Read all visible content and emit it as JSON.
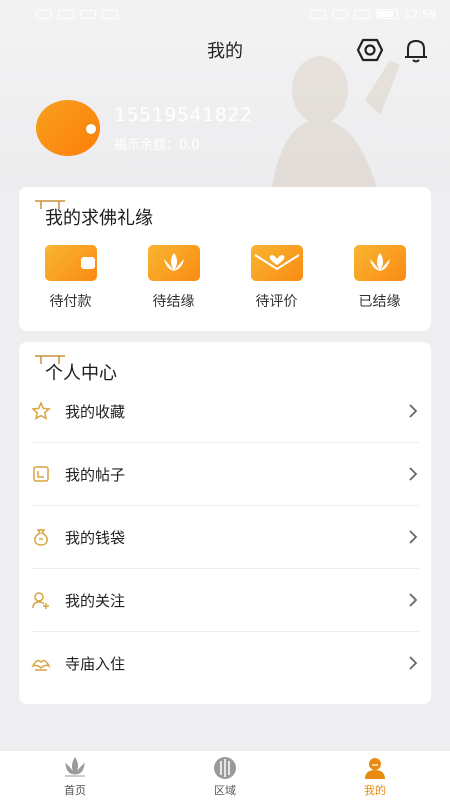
{
  "status_bar": {
    "time": "12:59"
  },
  "header": {
    "title": "我的"
  },
  "profile": {
    "phone": "15519541822",
    "balance_label": "福币余额：",
    "balance_value": "0.0"
  },
  "orders_card": {
    "title": "我的求佛礼缘",
    "items": [
      {
        "label": "待付款",
        "icon": "wallet-icon"
      },
      {
        "label": "待结缘",
        "icon": "lotus-icon"
      },
      {
        "label": "待评价",
        "icon": "heart-envelope-icon"
      },
      {
        "label": "已结缘",
        "icon": "lotus-icon"
      }
    ]
  },
  "personal_card": {
    "title": "个人中心",
    "items": [
      {
        "label": "我的收藏",
        "icon": "star-icon"
      },
      {
        "label": "我的帖子",
        "icon": "post-icon"
      },
      {
        "label": "我的钱袋",
        "icon": "money-bag-icon"
      },
      {
        "label": "我的关注",
        "icon": "follow-user-icon"
      },
      {
        "label": "寺庙入住",
        "icon": "temple-icon"
      }
    ]
  },
  "bottom_nav": {
    "tabs": [
      {
        "label": "首页",
        "icon": "lotus-home-icon",
        "active": false
      },
      {
        "label": "区域",
        "icon": "region-icon",
        "active": false
      },
      {
        "label": "我的",
        "icon": "monk-profile-icon",
        "active": true
      }
    ]
  },
  "colors": {
    "accent": "#f59a1b",
    "active_tab": "#e98a12"
  }
}
